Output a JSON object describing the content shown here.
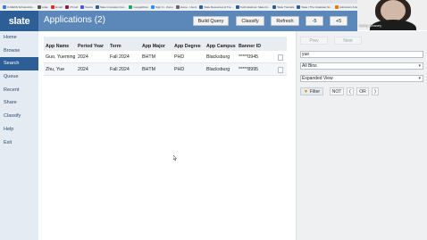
{
  "bookmarks": [
    {
      "label": "C-MENS Scholarship...",
      "color": "#3d7dd8"
    },
    {
      "label": "scale",
      "color": "#555555"
    },
    {
      "label": "Gmail",
      "color": "#d93025"
    },
    {
      "label": "VTmail",
      "color": "#861f41"
    },
    {
      "label": "Teams",
      "color": "#5059c9"
    },
    {
      "label": "Slate Innovation Gui...",
      "color": "#2d5f96"
    },
    {
      "label": "GoogleDrive",
      "color": "#1fa463"
    },
    {
      "label": "Sign In - Zoom",
      "color": "#2d8cff"
    },
    {
      "label": "Home - Users",
      "color": "#666666"
    },
    {
      "label": "Slate Resources & Tra...",
      "color": "#2d5f96"
    },
    {
      "label": "Technolatinos: Slate for...",
      "color": "#2d5f96"
    },
    {
      "label": "Slate Tutorials",
      "color": "#2d5f96"
    },
    {
      "label": "Slate | The Graduate Sc...",
      "color": "#2d5f96"
    },
    {
      "label": "Admission & Enroll...",
      "color": "#e07b00"
    }
  ],
  "header": {
    "logo": "slate",
    "title": "Applications (2)",
    "buttons": {
      "build_query": "Build Query",
      "classify": "Classify",
      "refresh": "Refresh",
      "minus5": "-5",
      "plus5": "+5"
    }
  },
  "webcam": {
    "name": "Kathy Chaney"
  },
  "sidebar": {
    "items": [
      {
        "label": "Home"
      },
      {
        "label": "Browse"
      },
      {
        "label": "Search",
        "active": true
      },
      {
        "label": "Queue"
      },
      {
        "label": "Recent"
      },
      {
        "label": "Share"
      },
      {
        "label": "Classify"
      },
      {
        "label": "Help"
      },
      {
        "label": "Exit"
      }
    ]
  },
  "table": {
    "headers": {
      "app_name": "App Name",
      "period_year": "Period Year",
      "term": "Term",
      "app_major": "App Major",
      "app_degree": "App Degree",
      "app_campus": "App Campus",
      "banner_id": "Banner ID"
    },
    "rows": [
      {
        "app_name": "Guo, Yueming",
        "period_year": "2024",
        "term": "Fall 2024",
        "app_major": "BHTM",
        "app_degree": "PHD",
        "app_campus": "Blacksburg",
        "banner_id": "*****0945"
      },
      {
        "app_name": "Zhu, Yue",
        "period_year": "2024",
        "term": "Fall 2024",
        "app_major": "BHTM",
        "app_degree": "PHD",
        "app_campus": "Blacksburg",
        "banner_id": "*****8995"
      }
    ]
  },
  "panel": {
    "prev": "Prev",
    "next": "Next",
    "search_value": "yue",
    "bins": "All Bins",
    "view": "Expanded View",
    "filter": "Filter",
    "not": "NOT",
    "open_paren": "(",
    "or": "OR",
    "close_paren": ")"
  }
}
